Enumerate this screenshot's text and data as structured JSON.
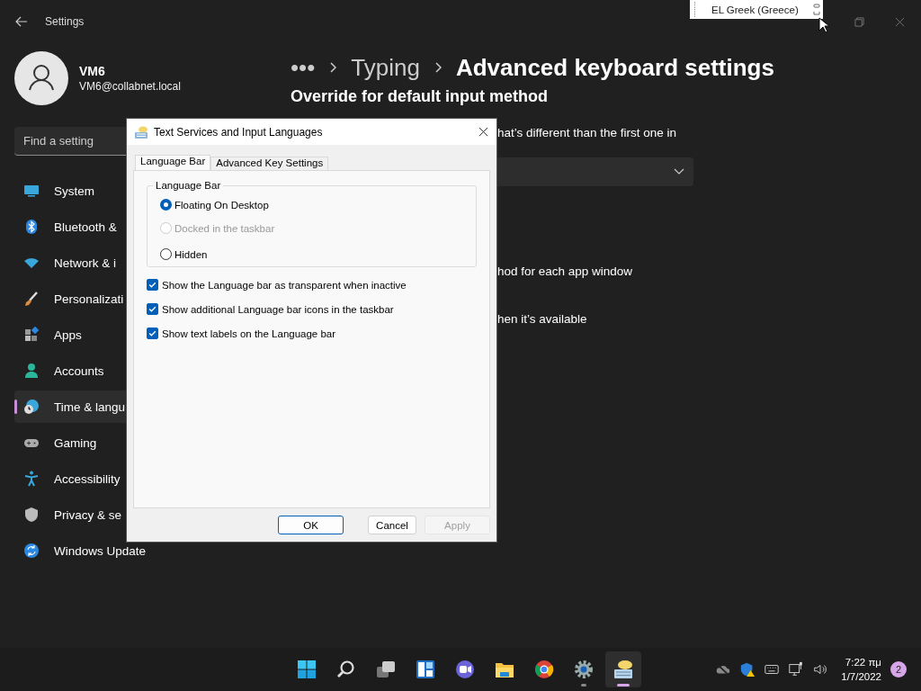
{
  "window": {
    "title": "Settings"
  },
  "user": {
    "name": "VM6",
    "email": "VM6@collabnet.local"
  },
  "search": {
    "placeholder": "Find a setting"
  },
  "sidebar": {
    "items": [
      {
        "kind": "system",
        "label": "System",
        "selected": false
      },
      {
        "kind": "bluetooth",
        "label": "Bluetooth &",
        "selected": false
      },
      {
        "kind": "network",
        "label": "Network & i",
        "selected": false
      },
      {
        "kind": "personalization",
        "label": "Personalizati",
        "selected": false
      },
      {
        "kind": "apps",
        "label": "Apps",
        "selected": false
      },
      {
        "kind": "accounts",
        "label": "Accounts",
        "selected": false
      },
      {
        "kind": "time",
        "label": "Time & langu",
        "selected": true
      },
      {
        "kind": "gaming",
        "label": "Gaming",
        "selected": false
      },
      {
        "kind": "accessibility",
        "label": "Accessibility",
        "selected": false
      },
      {
        "kind": "privacy",
        "label": "Privacy & se",
        "selected": false
      },
      {
        "kind": "update",
        "label": "Windows Update",
        "selected": false
      }
    ]
  },
  "breadcrumb": [
    "•••",
    "Typing",
    "Advanced keyboard settings"
  ],
  "content": {
    "heading": "Override for default input method",
    "texts": [
      "hat’s different than the first one in",
      "hod for each app window",
      "hen it’s available"
    ]
  },
  "language_bar": {
    "label": "EL Greek (Greece)"
  },
  "dialog": {
    "title": "Text Services and Input Languages",
    "tabs": [
      {
        "label": "Language Bar",
        "selected": true
      },
      {
        "label": "Advanced Key Settings",
        "selected": false
      }
    ],
    "group": {
      "title": "Language Bar",
      "options": [
        {
          "label": "Floating On Desktop",
          "selected": true,
          "disabled": false
        },
        {
          "label": "Docked in the taskbar",
          "selected": false,
          "disabled": true
        },
        {
          "label": "Hidden",
          "selected": false,
          "disabled": false
        }
      ]
    },
    "checkboxes": [
      {
        "label": "Show the Language bar as transparent when inactive",
        "checked": true
      },
      {
        "label": "Show additional Language bar icons in the taskbar",
        "checked": true
      },
      {
        "label": "Show text labels on the Language bar",
        "checked": true
      }
    ],
    "buttons": [
      {
        "label": "OK",
        "default": true,
        "disabled": false
      },
      {
        "label": "Cancel",
        "default": false,
        "disabled": false
      },
      {
        "label": "Apply",
        "default": false,
        "disabled": true
      }
    ]
  },
  "taskbar": {
    "apps": [
      {
        "kind": "start",
        "running": false,
        "active": false
      },
      {
        "kind": "search",
        "running": false,
        "active": false
      },
      {
        "kind": "taskview",
        "running": false,
        "active": false
      },
      {
        "kind": "widgets",
        "running": false,
        "active": false
      },
      {
        "kind": "chat",
        "running": false,
        "active": false
      },
      {
        "kind": "explorer",
        "running": false,
        "active": false
      },
      {
        "kind": "chrome",
        "running": false,
        "active": false
      },
      {
        "kind": "settings",
        "running": true,
        "active": false
      },
      {
        "kind": "keyboard",
        "running": true,
        "active": true
      }
    ],
    "clock": {
      "time": "7:22 πμ",
      "date": "1/7/2022"
    },
    "notifications": "2"
  }
}
